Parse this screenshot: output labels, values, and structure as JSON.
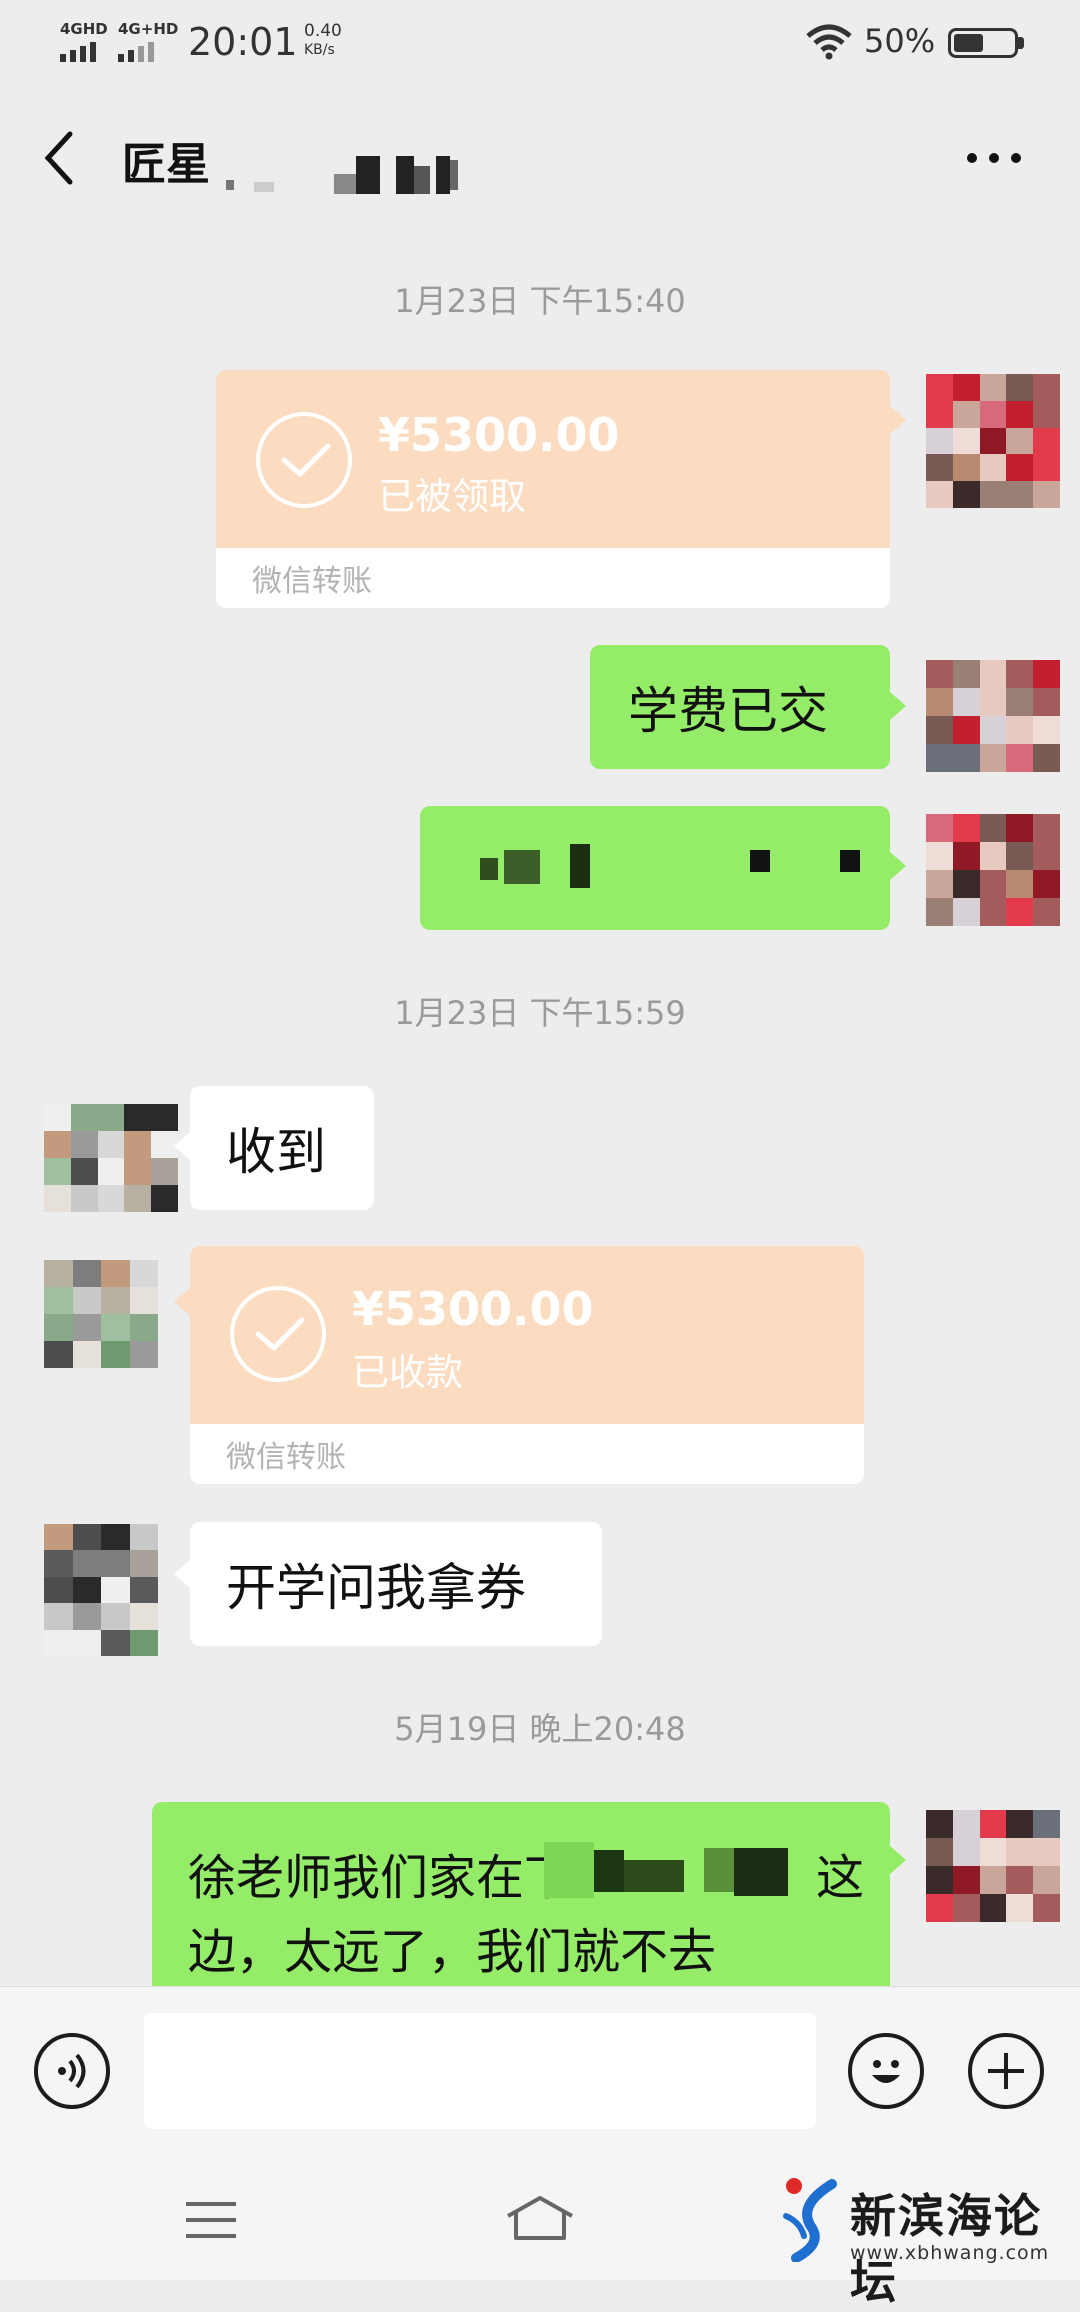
{
  "status_bar": {
    "network1": "4GHD",
    "network2": "4G+HD",
    "time": "20:01",
    "speed_value": "0.40",
    "speed_unit": "KB/s",
    "battery": "50%",
    "battery_level": 0.5
  },
  "header": {
    "title": "匠星"
  },
  "messages": {
    "ts1": "1月23日 下午15:40",
    "transfer1": {
      "amount": "¥5300.00",
      "status": "已被领取",
      "label": "微信转账"
    },
    "msg_fee": "学费已交",
    "ts2": "1月23日 下午15:59",
    "msg_received": "收到",
    "transfer2": {
      "amount": "¥5300.00",
      "status": "已收款",
      "label": "微信转账"
    },
    "msg_coupon": "开学问我拿券",
    "ts3": "5月19日 晚上20:48",
    "msg_long_line1_a": "徐老师我们家在下",
    "msg_long_line1_b": "这",
    "msg_long_line2": "边，太远了，我们就不去"
  },
  "input_bar": {
    "voice_icon": "voice-icon",
    "emoji_icon": "emoji-icon",
    "plus_icon": "plus-icon"
  },
  "watermark": {
    "name": "新滨海论坛",
    "url": "www.xbhwang.com"
  },
  "colors": {
    "background": "#ededed",
    "my_bubble": "#95ec69",
    "other_bubble": "#ffffff",
    "transfer_card": "#fbdcc0"
  }
}
